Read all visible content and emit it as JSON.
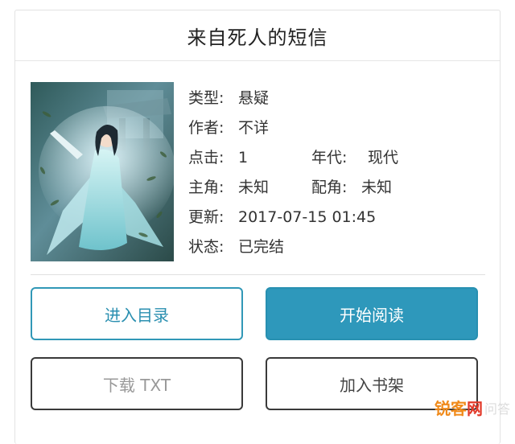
{
  "page": {
    "title": "来自死人的短信"
  },
  "cover": {
    "icon": "book-cover-image"
  },
  "info": {
    "type_label": "类型:",
    "type_value": "悬疑",
    "author_label": "作者:",
    "author_value": "不详",
    "clicks_label": "点击:",
    "clicks_value": "1",
    "era_label": "年代:",
    "era_value": "现代",
    "protagonist_label": "主角:",
    "protagonist_value": "未知",
    "supporting_label": "配角:",
    "supporting_value": "未知",
    "updated_label": "更新:",
    "updated_value": "2017-07-15 01:45",
    "status_label": "状态:",
    "status_value": "已完结"
  },
  "buttons": {
    "toc": "进入目录",
    "read": "开始阅读",
    "download": "下载 TXT",
    "shelf": "加入书架"
  },
  "watermark": {
    "part1": "锐客",
    "part2": "网",
    "part3": "问答"
  },
  "colors": {
    "accent": "#2e98bb",
    "border_dark": "#3a3a3a",
    "divider": "#e0e0e0"
  }
}
